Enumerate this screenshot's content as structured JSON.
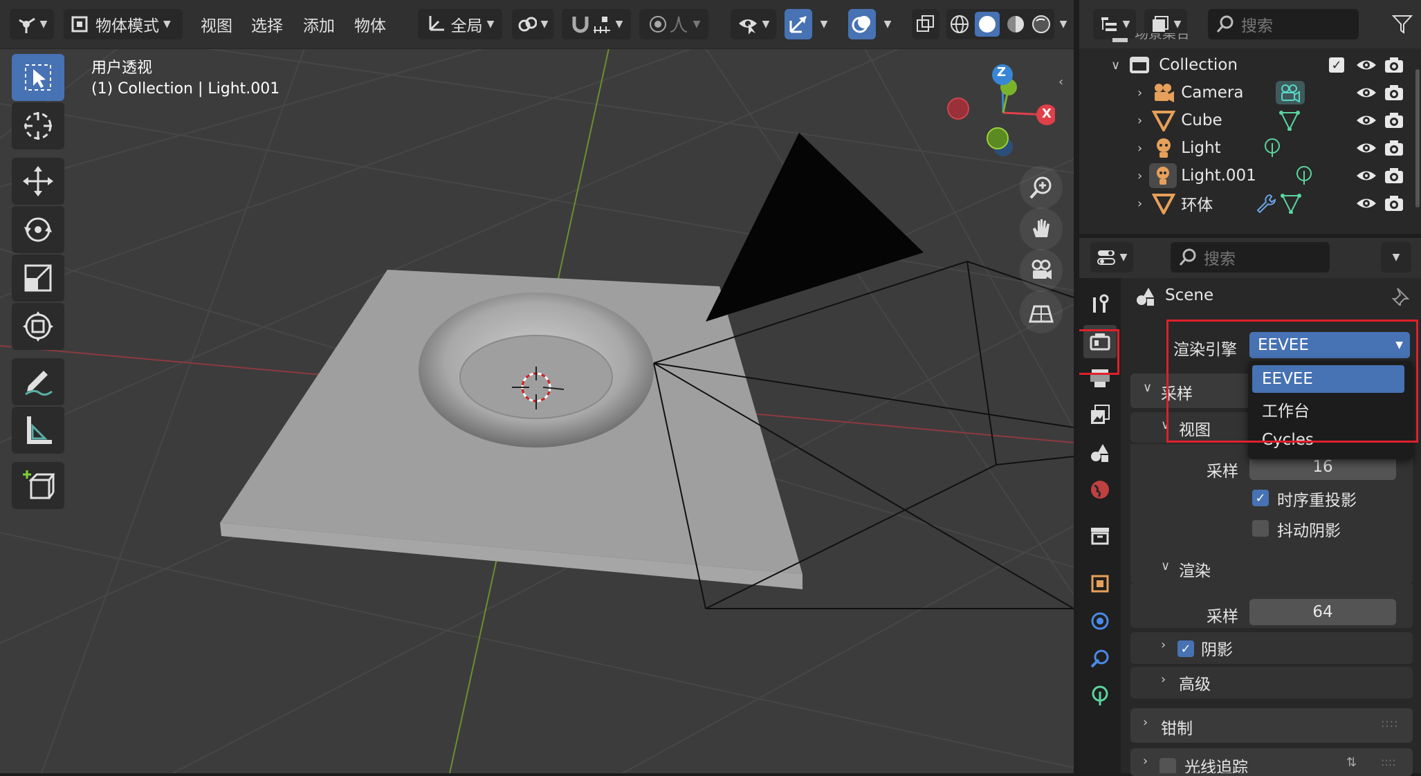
{
  "header": {
    "mode_label": "物体模式",
    "menus": [
      "视图",
      "选择",
      "添加",
      "物体"
    ],
    "transform_orientation": "全局"
  },
  "viewport": {
    "view_name": "用户透视",
    "collection_info": "(1) Collection | Light.001",
    "axes": {
      "x": "X",
      "y": "Y",
      "z": "Z"
    }
  },
  "outliner": {
    "search_placeholder": "搜索",
    "partial_top_label": "场景集合",
    "collection": "Collection",
    "items": [
      {
        "name": "Camera",
        "icon": "camera-icon",
        "data_icon": "camera-data-icon",
        "color": "#e6a05a"
      },
      {
        "name": "Cube",
        "icon": "mesh-icon",
        "data_icon": "mesh-data-icon",
        "color": "#e6a05a"
      },
      {
        "name": "Light",
        "icon": "light-icon",
        "data_icon": "light-data-icon",
        "color": "#e6a05a"
      },
      {
        "name": "Light.001",
        "icon": "light-icon",
        "data_icon": "light-data-icon",
        "color": "#e6a05a"
      },
      {
        "name": "环体",
        "icon": "mesh-icon",
        "data_icon": "modifier-wrench-icon",
        "color": "#e6a05a"
      }
    ]
  },
  "properties": {
    "search_placeholder": "搜索",
    "scene_label": "Scene",
    "render_engine_label": "渲染引擎",
    "render_engine_value": "EEVEE",
    "dropdown_options": [
      "EEVEE",
      "工作台",
      "Cycles"
    ],
    "sampling_section": "采样",
    "viewport_sub": "视图",
    "viewport_samples_label": "采样",
    "viewport_samples": "16",
    "temporal_reprojection": "时序重投影",
    "jitter_shadows": "抖动阴影",
    "render_sub": "渲染",
    "render_samples_label": "采样",
    "render_samples": "64",
    "shadows": "阴影",
    "advanced": "高级",
    "clamping": "钳制",
    "raytracing": "光线追踪"
  },
  "colors": {
    "accent": "#4772b3",
    "highlight_box": "#e0202a",
    "object_orange": "#e6a05a"
  }
}
